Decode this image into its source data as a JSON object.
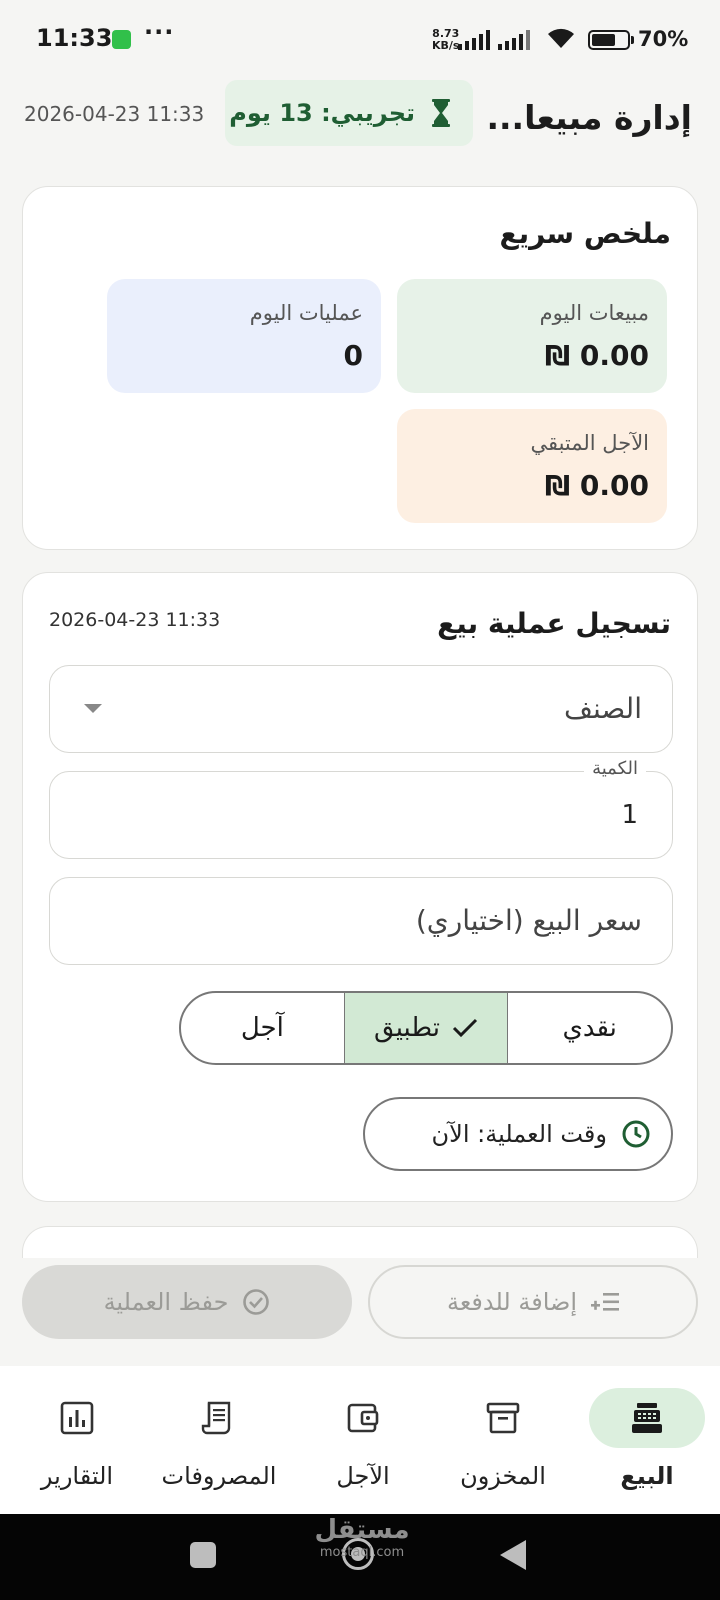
{
  "status_bar": {
    "time": "11:33",
    "more": "···",
    "net_speed_value": "8.73",
    "net_speed_unit": "KB/s",
    "battery": "70%",
    "battery_level": 0.7
  },
  "header": {
    "title": "إدارة مبيعا...",
    "trial_badge": "تجريبي: 13 يوم",
    "datetime": "2026-04-23 11:33"
  },
  "summary": {
    "title": "ملخص سريع",
    "today_sales_label": "مبيعات اليوم",
    "today_sales_value": "0.00 ₪",
    "today_ops_label": "عمليات اليوم",
    "today_ops_value": "0",
    "remaining_credit_label": "الآجل المتبقي",
    "remaining_credit_value": "0.00 ₪"
  },
  "sale_form": {
    "title": "تسجيل عملية بيع",
    "datetime": "2026-04-23 11:33",
    "item_placeholder": "الصنف",
    "quantity_label": "الكمية",
    "quantity_value": "1",
    "price_placeholder": "سعر البيع (اختياري)",
    "payment_options": [
      {
        "label": "نقدي",
        "selected": false
      },
      {
        "label": "تطبيق",
        "selected": true
      },
      {
        "label": "آجل",
        "selected": false
      }
    ],
    "time_button": "وقت العملية: الآن"
  },
  "actions": {
    "add_to_batch": "إضافة للدفعة",
    "save": "حفظ العملية"
  },
  "bottom_nav": {
    "items": [
      {
        "label": "البيع",
        "icon": "cash-register-icon",
        "active": true
      },
      {
        "label": "المخزون",
        "icon": "archive-box-icon",
        "active": false
      },
      {
        "label": "الآجل",
        "icon": "wallet-icon",
        "active": false
      },
      {
        "label": "المصروفات",
        "icon": "receipt-icon",
        "active": false
      },
      {
        "label": "التقارير",
        "icon": "bar-chart-icon",
        "active": false
      }
    ]
  },
  "watermark": {
    "arabic": "مستقل",
    "latin": "mostaql.com"
  },
  "colors": {
    "accent_green": "#1f5e33",
    "selected_segment": "#d2e9d4",
    "sales_tile": "#e7f2e8",
    "ops_tile": "#eaeffc",
    "credit_tile": "#fdefe2"
  }
}
